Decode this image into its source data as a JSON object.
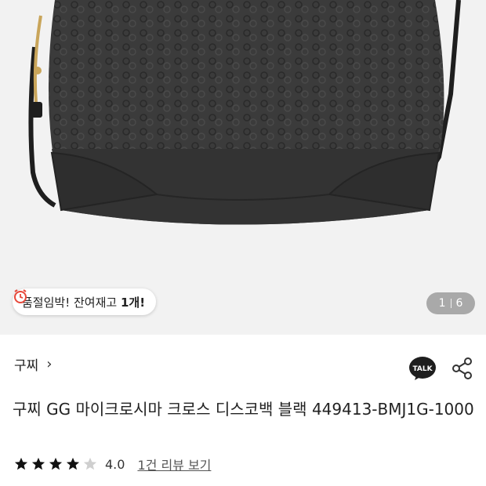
{
  "product": {
    "stock_alert_text": "품절임박! 잔여재고 ",
    "stock_count": "1개!",
    "image_counter": {
      "current": "1",
      "total": "6"
    },
    "brand": "구찌",
    "title": "구찌 GG 마이크로시마 크로스 디스코백 블랙 449413-BMJ1G-1000",
    "rating_score": "4.0",
    "rating_value": 4,
    "rating_max": 5,
    "reviews_link": "1건 리뷰 보기",
    "talk_label": "TALK"
  }
}
